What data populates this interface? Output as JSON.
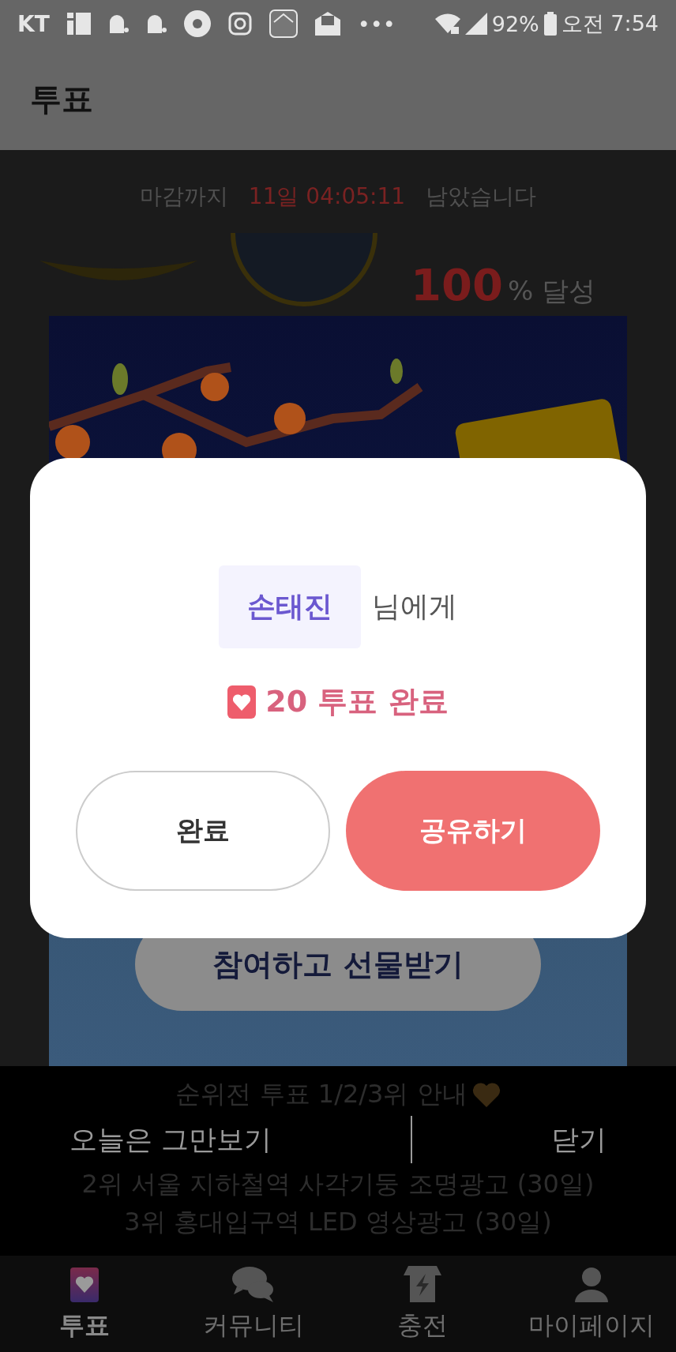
{
  "status_bar": {
    "carrier": "KT",
    "more": "•••",
    "battery": "92%",
    "time": "오전 7:54"
  },
  "app_bar": {
    "title": "투표"
  },
  "countdown": {
    "prefix": "마감까지",
    "remaining": "11일 04:05:11",
    "suffix": "남았습니다"
  },
  "progress": {
    "percent": "100",
    "unit": "% 달성"
  },
  "banner": {
    "button": "참여하고 선물받기"
  },
  "dialog": {
    "recipient": "손태진",
    "recipient_suffix": "님에게",
    "votes": "20 투표 완료",
    "buttons": [
      {
        "label": "완료",
        "kind": "outline"
      },
      {
        "label": "공유하기",
        "kind": "filled"
      }
    ]
  },
  "notice": {
    "title": "순위전 투표 1/2/3위 안내",
    "lines": [
      "2위 서울 지하철역 사각기둥 조명광고 (30일)",
      "3위 홍대입구역 LED 영상광고 (30일)"
    ]
  },
  "popup_actions": {
    "dismiss_today": "오늘은 그만보기",
    "close": "닫기"
  },
  "tabs": [
    {
      "label": "투표",
      "selected": true
    },
    {
      "label": "커뮤니티",
      "selected": false
    },
    {
      "label": "충전",
      "selected": false
    },
    {
      "label": "마이페이지",
      "selected": false
    }
  ]
}
